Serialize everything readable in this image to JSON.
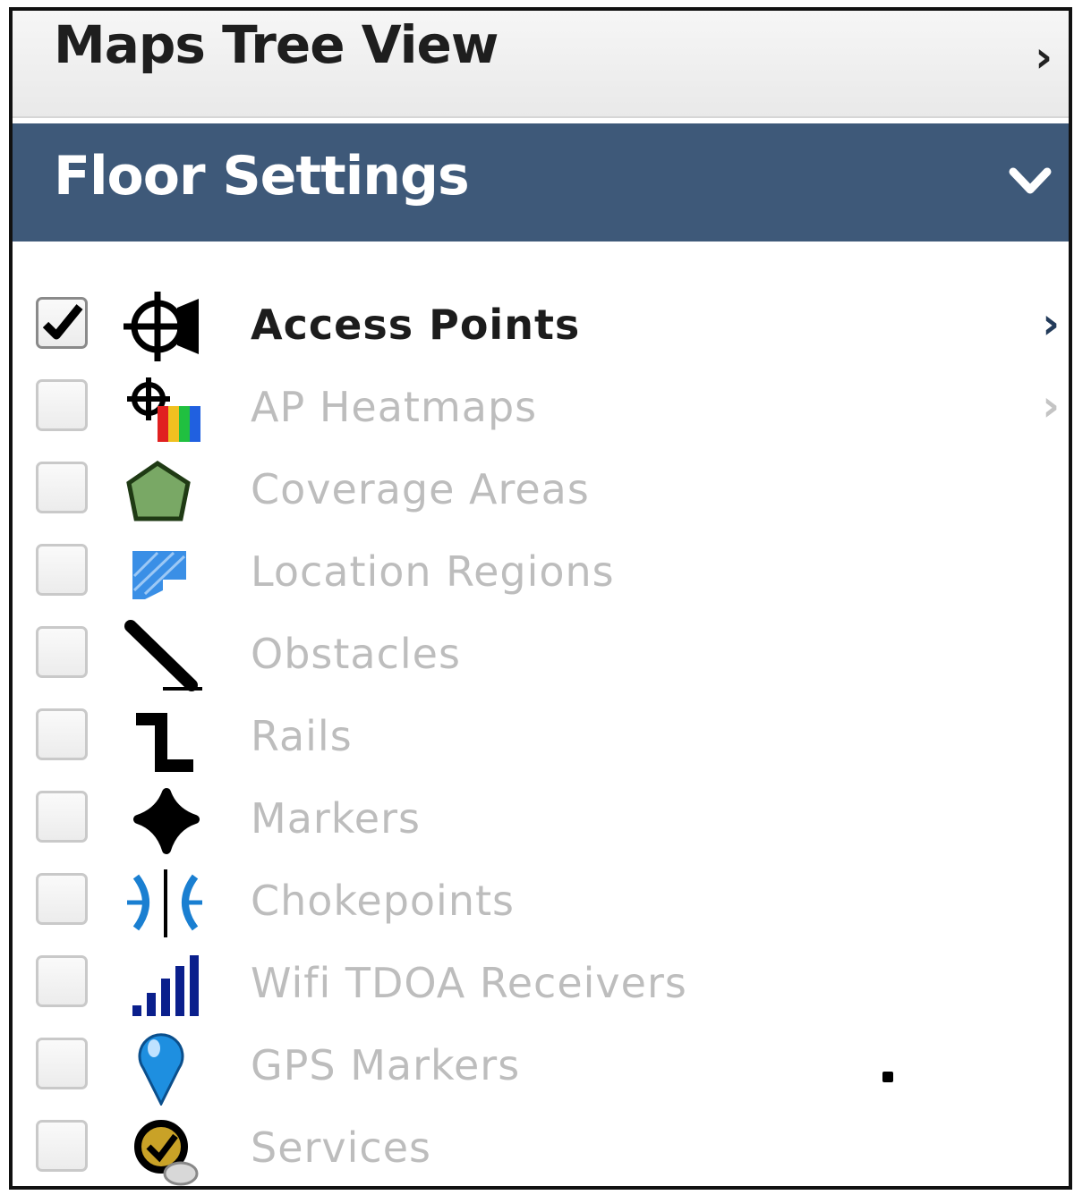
{
  "maps_tree_view": {
    "title": "Maps Tree View",
    "expand_glyph": "›"
  },
  "floor_settings": {
    "title": "Floor Settings"
  },
  "layers": [
    {
      "label": "Access Points",
      "checked": true,
      "icon": "access-point-icon",
      "has_submenu": true,
      "active": true
    },
    {
      "label": "AP Heatmaps",
      "checked": false,
      "icon": "heatmap-icon",
      "has_submenu": true
    },
    {
      "label": "Coverage Areas",
      "checked": false,
      "icon": "coverage-area-icon",
      "has_submenu": false
    },
    {
      "label": "Location Regions",
      "checked": false,
      "icon": "location-region-icon",
      "has_submenu": false
    },
    {
      "label": "Obstacles",
      "checked": false,
      "icon": "obstacle-icon",
      "has_submenu": false
    },
    {
      "label": "Rails",
      "checked": false,
      "icon": "rail-icon",
      "has_submenu": false
    },
    {
      "label": "Markers",
      "checked": false,
      "icon": "marker-icon",
      "has_submenu": false
    },
    {
      "label": "Chokepoints",
      "checked": false,
      "icon": "chokepoint-icon",
      "has_submenu": false
    },
    {
      "label": "Wifi TDOA Receivers",
      "checked": false,
      "icon": "tdoa-receiver-icon",
      "has_submenu": false
    },
    {
      "label": "GPS Markers",
      "checked": false,
      "icon": "gps-marker-icon",
      "has_submenu": false
    },
    {
      "label": "Services",
      "checked": false,
      "icon": "services-icon",
      "has_submenu": false
    }
  ],
  "colors": {
    "floor_header_bg": "#3e5979",
    "active_text": "#1c1c1c",
    "inactive_text": "#bdbdbd",
    "chokepoint_blue": "#1a7fd1",
    "heatmap_colors": [
      "#e02020",
      "#f0c020",
      "#20c040",
      "#2060e0"
    ]
  }
}
